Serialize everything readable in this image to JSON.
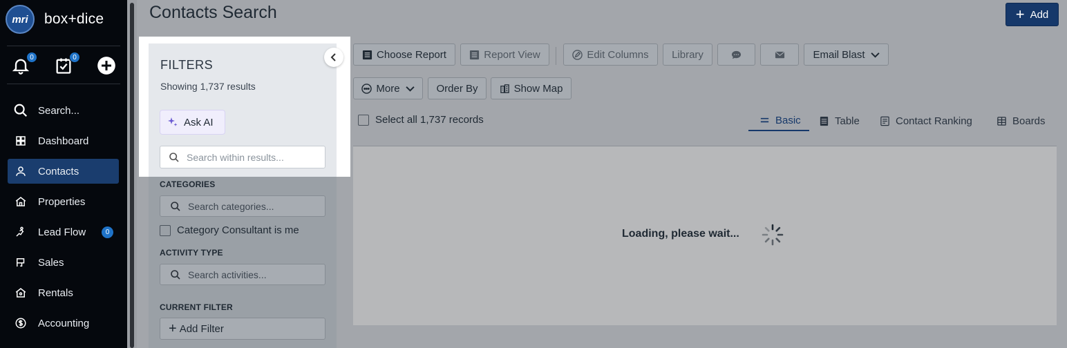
{
  "app": {
    "logo_text": "mri",
    "brand": "box+dice"
  },
  "quick": {
    "notifications_count": "0",
    "tasks_count": "0"
  },
  "sidebar": {
    "items": [
      {
        "label": "Search...",
        "icon": "search-icon"
      },
      {
        "label": "Dashboard",
        "icon": "dashboard-icon"
      },
      {
        "label": "Contacts",
        "icon": "person-icon",
        "active": true
      },
      {
        "label": "Properties",
        "icon": "home-icon"
      },
      {
        "label": "Lead Flow",
        "icon": "lead-flow-icon",
        "badge": "0"
      },
      {
        "label": "Sales",
        "icon": "sales-icon"
      },
      {
        "label": "Rentals",
        "icon": "rentals-icon"
      },
      {
        "label": "Accounting",
        "icon": "dollar-icon"
      }
    ]
  },
  "header": {
    "title": "Contacts Search",
    "add_label": "Add"
  },
  "filters": {
    "title": "FILTERS",
    "result_count": "Showing 1,737 results",
    "ask_ai_label": "Ask AI",
    "search_placeholder": "Search within results...",
    "categories_label": "CATEGORIES",
    "categories_placeholder": "Search categories...",
    "category_consultant_label": "Category Consultant is me",
    "activity_type_label": "ACTIVITY TYPE",
    "activities_placeholder": "Search activities...",
    "current_filter_label": "CURRENT FILTER",
    "add_filter_label": "Add Filter"
  },
  "toolbar": {
    "choose_report": "Choose Report",
    "report_view": "Report View",
    "edit_columns": "Edit Columns",
    "library": "Library",
    "email_blast": "Email Blast",
    "more": "More",
    "order_by": "Order By",
    "show_map": "Show Map"
  },
  "results": {
    "select_all_label": "Select all 1,737 records",
    "loading_text": "Loading, please wait..."
  },
  "tabs": [
    {
      "label": "Basic",
      "active": true
    },
    {
      "label": "Table"
    },
    {
      "label": "Contact Ranking"
    },
    {
      "label": "Boards"
    }
  ],
  "colors": {
    "accent": "#16386a",
    "sidebar_bg": "#05080d",
    "badge": "#1f73c8"
  }
}
